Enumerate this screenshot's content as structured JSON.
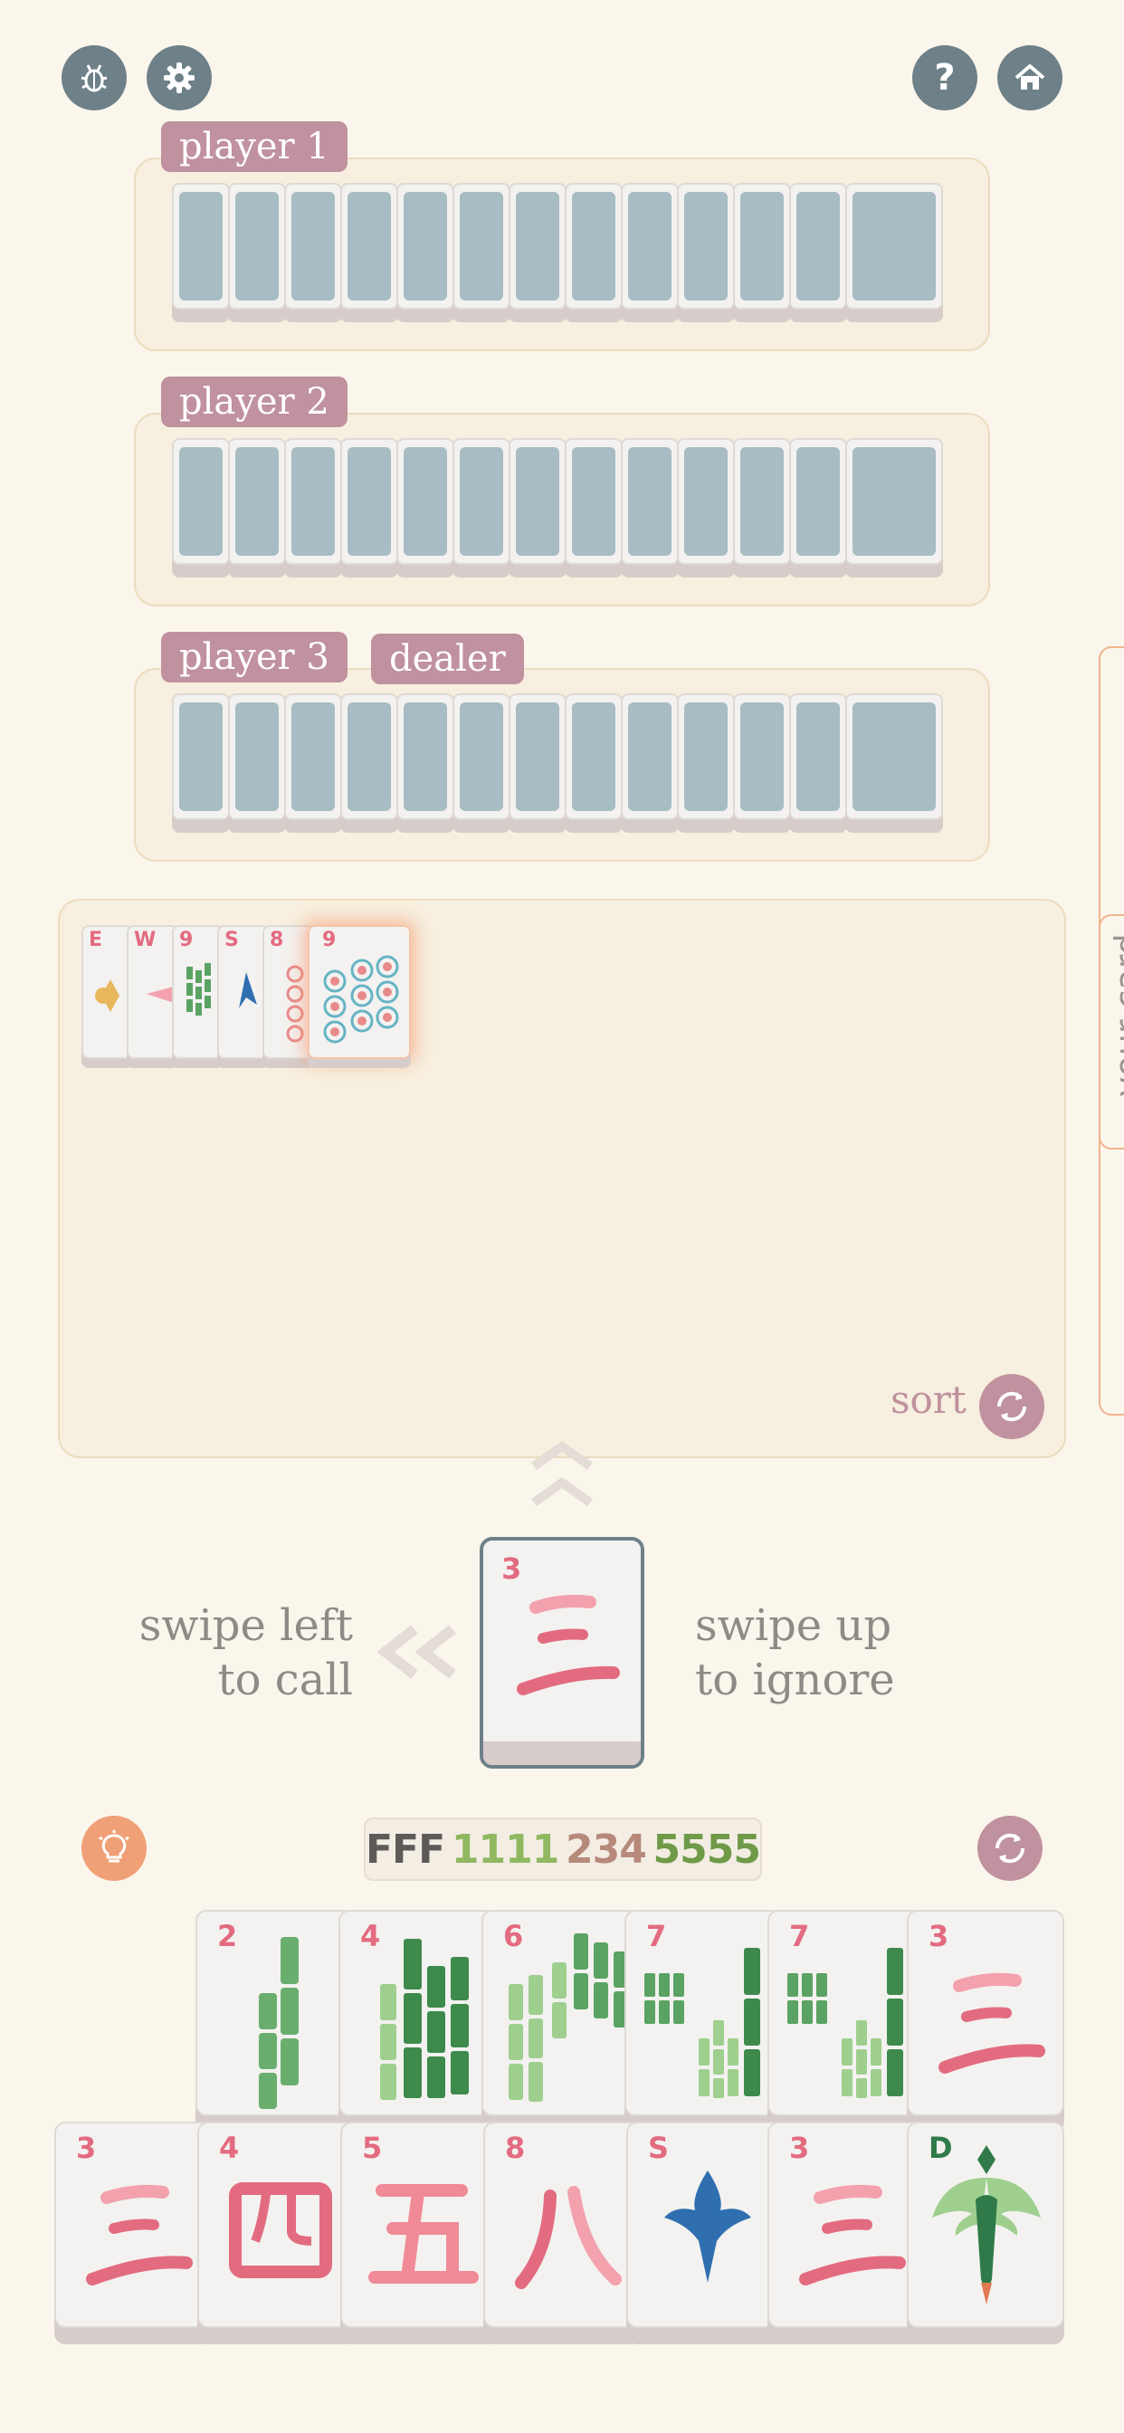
{
  "top_bar": {
    "bug_icon": "bug-icon",
    "settings_icon": "gear-icon",
    "help_icon": "question-icon",
    "home_icon": "home-icon"
  },
  "players": [
    {
      "name": "player 1",
      "tile_count": 13
    },
    {
      "name": "player 2",
      "tile_count": 13
    },
    {
      "name": "player 3",
      "tile_count": 13,
      "badge": "dealer"
    }
  ],
  "discards": {
    "tiles": [
      {
        "label": "E",
        "kind": "wind"
      },
      {
        "label": "W",
        "kind": "wind"
      },
      {
        "label": "9",
        "kind": "bamboo"
      },
      {
        "label": "S",
        "kind": "wind"
      },
      {
        "label": "8",
        "kind": "dots"
      },
      {
        "label": "9",
        "kind": "dots",
        "highlighted": true
      }
    ],
    "sort_label": "sort"
  },
  "side_tab": {
    "label": "your card"
  },
  "offered_tile": {
    "label": "3",
    "kind": "character"
  },
  "swipe": {
    "left_line1": "swipe left",
    "left_line2": "to call",
    "up_line1": "swipe up",
    "up_line2": "to ignore"
  },
  "pattern": {
    "segments": [
      {
        "text": "FFF",
        "color": "#5d5a58"
      },
      {
        "text": "1111",
        "color": "#8fb861"
      },
      {
        "text": "234",
        "color": "#b7897b"
      },
      {
        "text": "5555",
        "color": "#6f9a48"
      }
    ]
  },
  "hand": {
    "top_row": [
      {
        "label": "2",
        "kind": "bamboo"
      },
      {
        "label": "4",
        "kind": "bamboo"
      },
      {
        "label": "6",
        "kind": "bamboo"
      },
      {
        "label": "7",
        "kind": "bamboo"
      },
      {
        "label": "7",
        "kind": "bamboo"
      },
      {
        "label": "3",
        "kind": "character"
      }
    ],
    "bottom_row": [
      {
        "label": "3",
        "kind": "character"
      },
      {
        "label": "4",
        "kind": "character"
      },
      {
        "label": "5",
        "kind": "character"
      },
      {
        "label": "8",
        "kind": "character"
      },
      {
        "label": "S",
        "kind": "wind"
      },
      {
        "label": "3",
        "kind": "character"
      },
      {
        "label": "D",
        "kind": "dragon"
      }
    ]
  },
  "colors": {
    "background": "#fbf6ec",
    "tag": "#c0919e",
    "tile_back": "#a7bcc3",
    "character_red": "#e36b80",
    "bamboo_green": "#4f9a58",
    "hint": "#f0a076"
  }
}
